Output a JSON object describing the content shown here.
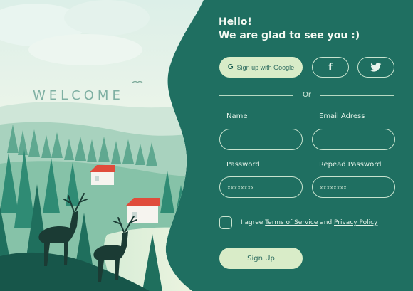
{
  "hero": {
    "welcome": "WELCOME"
  },
  "form": {
    "greeting_line1": "Hello!",
    "greeting_line2": "We are glad to see you :)",
    "google_label": "Sign up with Google",
    "google_icon": "G",
    "facebook_icon": "f",
    "or_label": "Or",
    "name_label": "Name",
    "email_label": "Email Adress",
    "password_label": "Password",
    "repeat_password_label": "Repead Password",
    "name_value": "",
    "email_value": "",
    "password_placeholder": "xxxxxxxx",
    "repeat_password_placeholder": "xxxxxxxx",
    "agree_prefix": "I agree ",
    "terms_link": "Terms of Service",
    "agree_and": " and ",
    "privacy_link": "Privacy Policy",
    "signup_label": "Sign Up"
  },
  "colors": {
    "panel": "#1f6f61",
    "accent_button": "#d9ecc8",
    "outline": "#c8e3cf"
  }
}
